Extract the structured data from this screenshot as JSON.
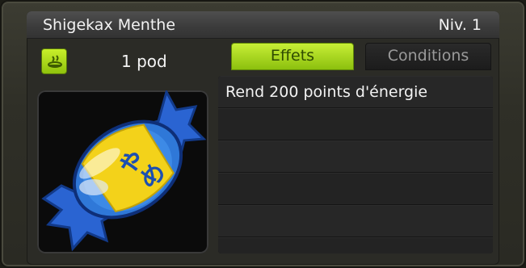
{
  "item": {
    "name": "Shigekax Menthe",
    "level": "Niv. 1",
    "weight": "1 pod",
    "category_icon": "consumable-icon",
    "image": "mint-candy-icon"
  },
  "tabs": [
    {
      "label": "Effets",
      "active": true
    },
    {
      "label": "Conditions",
      "active": false
    }
  ],
  "effects": [
    "Rend 200 points d'énergie",
    "",
    "",
    "",
    "",
    ""
  ],
  "colors": {
    "accent": "#a6d81a",
    "candy_blue": "#2f78d8",
    "candy_yellow": "#f3d21a"
  }
}
